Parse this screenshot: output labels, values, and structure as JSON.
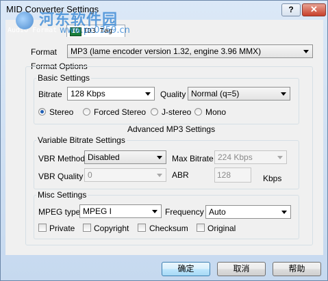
{
  "window": {
    "title": "MID Converter Settings",
    "help_btn": "?",
    "close_btn": "✕"
  },
  "watermark": {
    "text": "河东软件园",
    "url": "www.pc0359.cn"
  },
  "tabs": [
    {
      "label": "Audio Format"
    },
    {
      "badge": "ID",
      "label": "ID3 Tag"
    }
  ],
  "format": {
    "label": "Format",
    "value": "MP3 (lame encoder version 1.32, engine 3.96 MMX)"
  },
  "format_options": {
    "label": "Format Options"
  },
  "basic": {
    "label": "Basic Settings",
    "bitrate_label": "Bitrate",
    "bitrate_value": "128 Kbps",
    "quality_label": "Quality",
    "quality_value": "Normal (q=5)",
    "modes": [
      "Stereo",
      "Forced Stereo",
      "J-stereo",
      "Mono"
    ],
    "selected_mode": "Stereo"
  },
  "advanced": {
    "label": "Advanced MP3 Settings"
  },
  "vbr": {
    "label": "Variable Bitrate Settings",
    "method_label": "VBR Method",
    "method_value": "Disabled",
    "max_label": "Max Bitrate",
    "max_value": "224 Kbps",
    "quality_label": "VBR Quality",
    "quality_value": "0",
    "abr_label": "ABR",
    "abr_value": "128",
    "abr_unit": "Kbps"
  },
  "misc": {
    "label": "Misc Settings",
    "mpeg_label": "MPEG type",
    "mpeg_value": "MPEG I",
    "freq_label": "Frequency",
    "freq_value": "Auto",
    "checks": [
      "Private",
      "Copyright",
      "Checksum",
      "Original"
    ]
  },
  "buttons": {
    "ok": "确定",
    "cancel": "取消",
    "help": "帮助"
  }
}
